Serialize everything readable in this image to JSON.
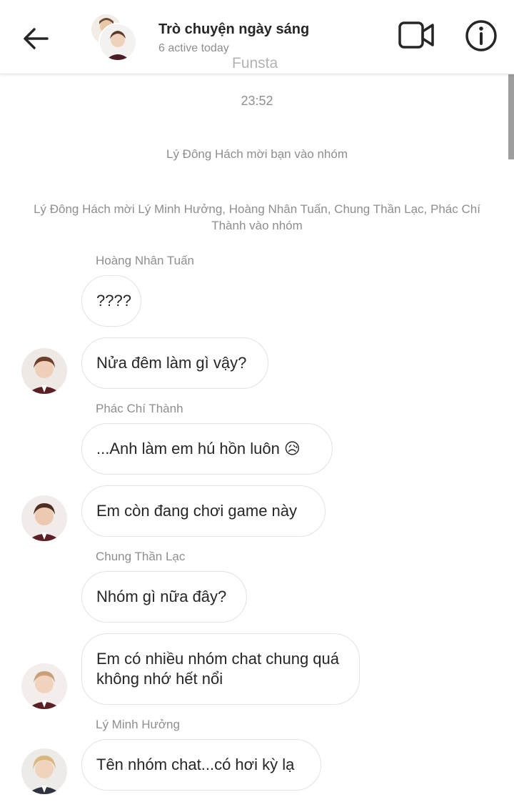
{
  "header": {
    "title": "Trò chuyện ngày sáng",
    "status": "6 active today"
  },
  "watermark": "Funsta",
  "timestamp": "23:52",
  "system_messages": [
    "Lý Đông Hách mời bạn vào nhóm",
    "Lý Đông Hách mời Lý Minh Hưởng, Hoàng Nhân Tuấn, Chung Thần Lạc, Phác Chí Thành vào nhóm"
  ],
  "messages": [
    {
      "sender": "Hoàng Nhân Tuấn",
      "text": "????"
    },
    {
      "text": "Nửa đêm làm gì vậy?"
    },
    {
      "sender": "Phác Chí Thành",
      "text": "...Anh làm em hú hồn luôn 😥"
    },
    {
      "text": "Em còn đang chơi game này"
    },
    {
      "sender": "Chung Thần Lạc",
      "text": "Nhóm gì nữa đây?"
    },
    {
      "text": "Em có nhiều nhóm chat chung quá không nhớ hết nổi"
    },
    {
      "sender": "Lý Minh Hưởng",
      "text": "Tên nhóm chat...có hơi kỳ lạ"
    }
  ],
  "colors": {
    "text": "#262626",
    "muted": "#8e8e8e",
    "border": "#e2e2e2"
  },
  "icons": [
    "back-arrow-icon",
    "video-call-icon",
    "info-icon"
  ]
}
